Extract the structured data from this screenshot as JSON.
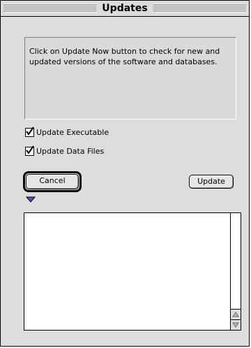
{
  "window": {
    "title": "Updates"
  },
  "info": {
    "message": "Click on Update Now button to check for new and updated versions of the software and databases."
  },
  "options": [
    {
      "label": "Update Executable",
      "checked": true
    },
    {
      "label": "Update Data Files",
      "checked": true
    }
  ],
  "buttons": {
    "cancel": "Cancel",
    "update": "Update"
  },
  "log": {
    "text": ""
  },
  "icons": {
    "disclosure": "disclosure-triangle-icon",
    "check": "checkmark-icon"
  },
  "colors": {
    "window_bg": "#dddddd",
    "disclosure": "#5a50c8"
  }
}
